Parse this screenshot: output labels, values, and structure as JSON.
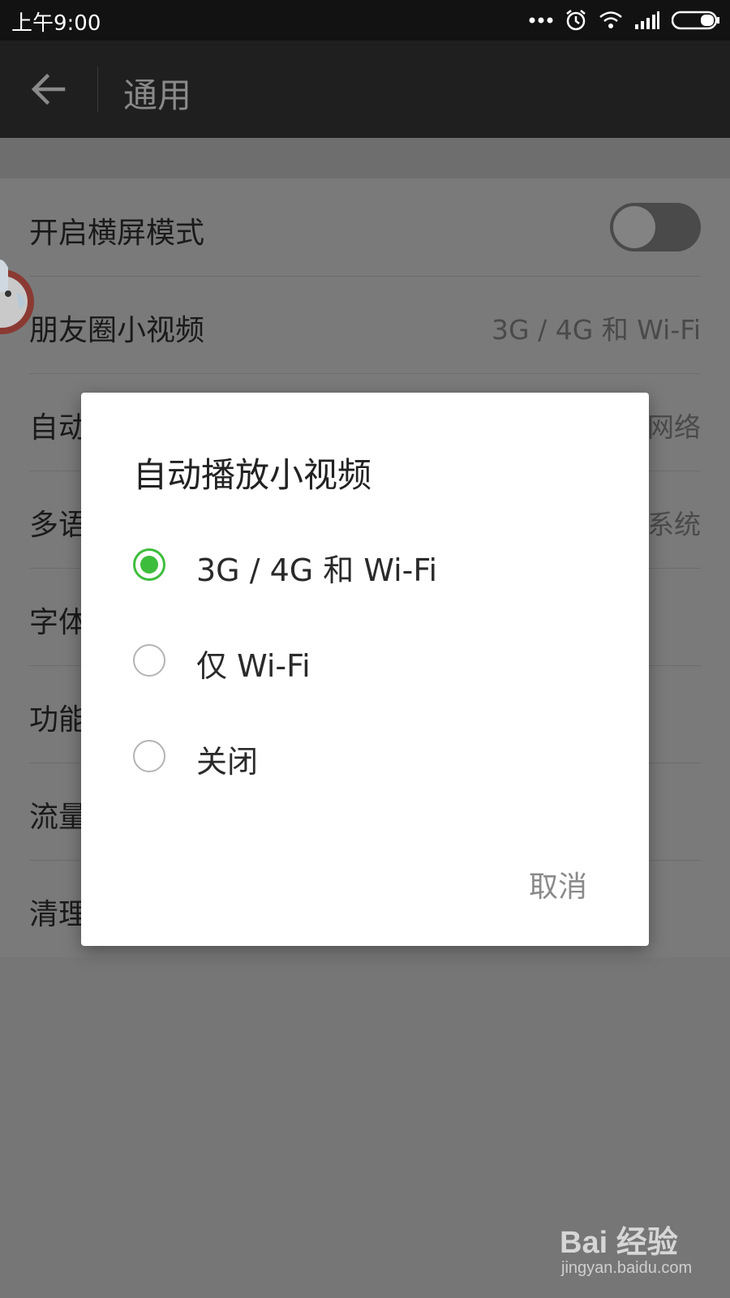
{
  "status_bar": {
    "time": "上午9:00",
    "icons": [
      "more-dots-icon",
      "alarm-icon",
      "wifi-icon",
      "signal-icon",
      "battery-icon"
    ]
  },
  "app_bar": {
    "title": "通用",
    "back_icon": "back-arrow-icon"
  },
  "settings": {
    "rows": [
      {
        "label": "开启横屏模式",
        "value": "",
        "toggle": false
      },
      {
        "label": "朋友圈小视频",
        "value": "3G / 4G 和 Wi-Fi"
      },
      {
        "label": "自动",
        "value": "网络"
      },
      {
        "label": "多语",
        "value": "系统"
      },
      {
        "label": "字体",
        "value": ""
      },
      {
        "label": "功能",
        "value": ""
      },
      {
        "label": "流量",
        "value": ""
      },
      {
        "label": "清理",
        "value": ""
      }
    ]
  },
  "dialog": {
    "title": "自动播放小视频",
    "options": [
      {
        "label": "3G / 4G 和 Wi-Fi",
        "selected": true
      },
      {
        "label": "仅 Wi-Fi",
        "selected": false
      },
      {
        "label": "关闭",
        "selected": false
      }
    ],
    "cancel_label": "取消"
  },
  "watermark": {
    "brand": "Bai 经验",
    "url": "jingyan.baidu.com"
  },
  "colors": {
    "accent_green": "#3dbd3c",
    "appbar_bg": "#1f1f1f",
    "statusbar_bg": "#121212",
    "scrim": "#767676"
  }
}
